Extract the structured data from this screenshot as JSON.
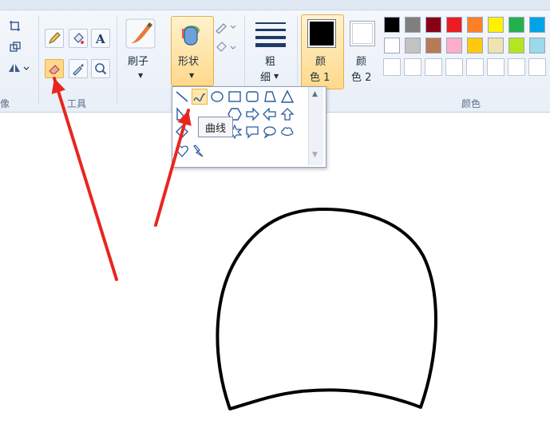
{
  "ribbon": {
    "groups": {
      "image_label": "像",
      "tools_label": "工具",
      "colors_label": "颜色"
    },
    "brush_label": "刷子",
    "shapes_label": "形状",
    "thickness_label_1": "粗",
    "thickness_label_2": "细",
    "color1_label_1": "颜",
    "color1_label_2": "色 1",
    "color2_label_1": "颜",
    "color2_label_2": "色 2",
    "selected_tool": "eraser-icon",
    "palette_row1": [
      "#000000",
      "#7f7f7f",
      "#880015",
      "#ed1c24",
      "#ff7f27",
      "#fff200",
      "#22b14c",
      "#00a2e8"
    ],
    "palette_row2": [
      "#ffffff",
      "#c3c3c3",
      "#b97a57",
      "#ffaec9",
      "#ffc90e",
      "#efe4b0",
      "#b5e61d",
      "#99d9ea"
    ],
    "color1": "#000000",
    "color2": "#ffffff",
    "accent": "#ffd98a"
  },
  "shapes_popup": {
    "tooltip": "曲线",
    "highlighted_shape": "curve"
  },
  "annotation_color": "#e8261f"
}
